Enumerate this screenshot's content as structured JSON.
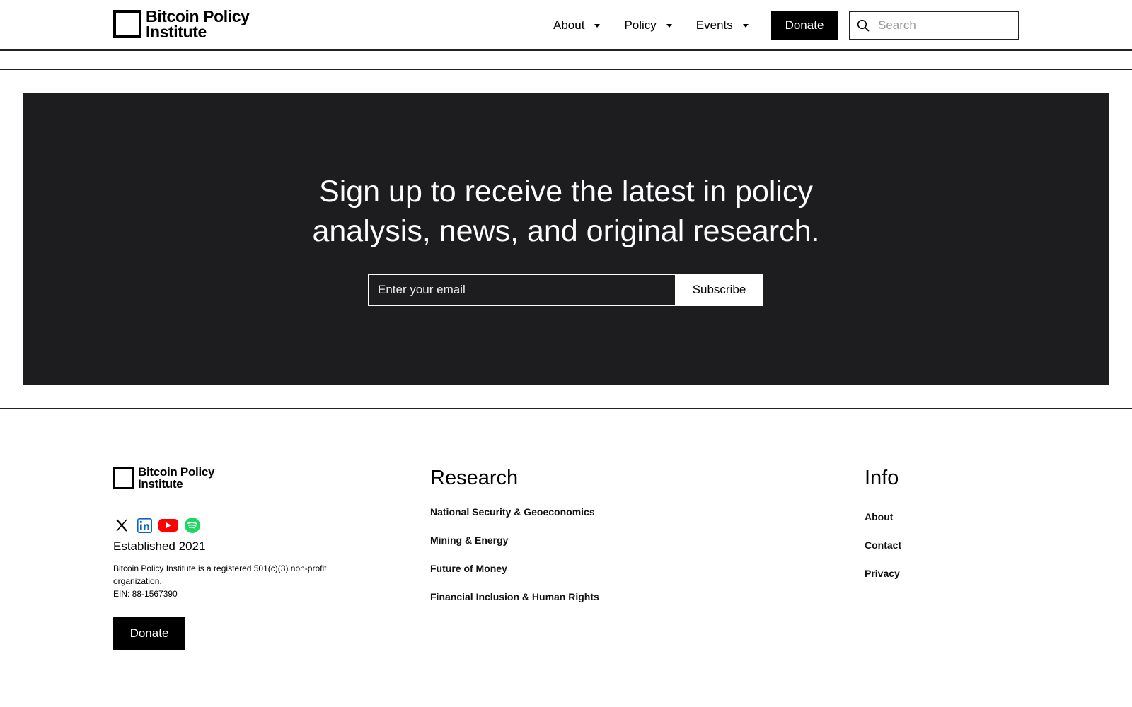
{
  "header": {
    "logo": {
      "line1": "Bitcoin Policy",
      "line2": "Institute"
    },
    "nav": [
      {
        "label": "About"
      },
      {
        "label": "Policy"
      },
      {
        "label": "Events"
      }
    ],
    "donate_label": "Donate",
    "search": {
      "placeholder": "Search",
      "icon": "search-icon"
    }
  },
  "newsletter": {
    "title_line1": "Sign up to receive the latest in policy",
    "title_line2": "analysis, news, and original research.",
    "email_placeholder": "Enter your email",
    "subscribe_label": "Subscribe"
  },
  "footer": {
    "logo": {
      "line1": "Bitcoin Policy",
      "line2": "Institute"
    },
    "socials": [
      {
        "icon": "x-icon"
      },
      {
        "icon": "linkedin-icon",
        "color": "#0a66c2"
      },
      {
        "icon": "youtube-icon",
        "color": "#ff0000"
      },
      {
        "icon": "spotify-icon",
        "color": "#1ed760"
      }
    ],
    "established": "Established 2021",
    "nonprofit": "Bitcoin Policy Institute is a registered 501(c)(3) non-profit organization.",
    "ein": "EIN: 88-1567390",
    "donate_label": "Donate",
    "research": {
      "heading": "Research",
      "links": [
        "National Security & Geoeconomics",
        "Mining & Energy",
        "Future of Money",
        "Financial Inclusion & Human Rights"
      ]
    },
    "info": {
      "heading": "Info",
      "links": [
        "About",
        "Contact",
        "Privacy"
      ]
    }
  }
}
